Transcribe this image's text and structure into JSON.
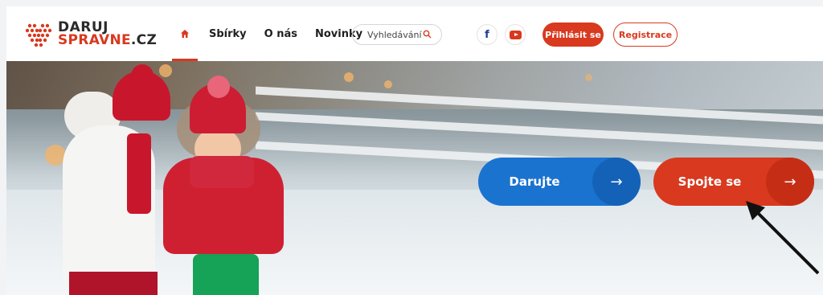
{
  "logo": {
    "line1": "DARUJ",
    "line2_main": "SPRAVNE",
    "line2_suffix": ".CZ"
  },
  "nav": {
    "home_icon": "home-icon",
    "items": [
      {
        "label": "Sbírky"
      },
      {
        "label": "O nás"
      },
      {
        "label": "Novinky"
      }
    ]
  },
  "search": {
    "placeholder": "Vyhledávání",
    "icon": "search-icon"
  },
  "social": {
    "facebook_icon": "facebook-icon",
    "youtube_icon": "youtube-icon"
  },
  "auth": {
    "login_label": "Přihlásit se",
    "register_label": "Registrace"
  },
  "hero": {
    "donate_label": "Darujte",
    "connect_label": "Spojte se",
    "arrow": "→"
  },
  "colors": {
    "accent": "#d8391f",
    "donate": "#1b73d0"
  }
}
